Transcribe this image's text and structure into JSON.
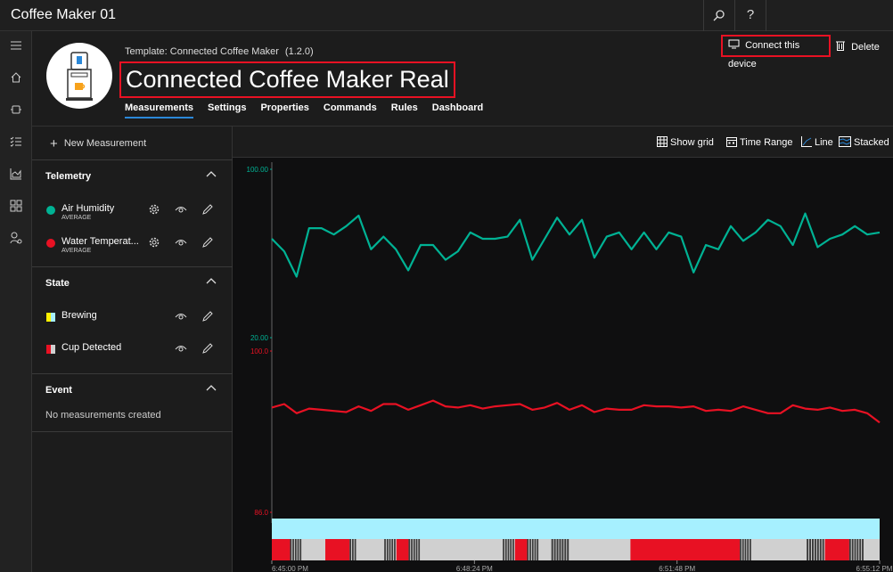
{
  "app": {
    "title": "Coffee Maker 01",
    "search_icon": "search-icon",
    "help_label": "?"
  },
  "header": {
    "template_label": "Template:",
    "template_name": "Connected Coffee Maker",
    "template_version": "(1.2.0)",
    "device_name": "Connected Coffee Maker Real",
    "connect_label": "Connect this device",
    "delete_label": "Delete",
    "tabs": [
      {
        "label": "Measurements",
        "active": true
      },
      {
        "label": "Settings"
      },
      {
        "label": "Properties"
      },
      {
        "label": "Commands"
      },
      {
        "label": "Rules"
      },
      {
        "label": "Dashboard"
      }
    ]
  },
  "left": {
    "new_measurement": "New Measurement",
    "telemetry": {
      "title": "Telemetry",
      "items": [
        {
          "label": "Air Humidity",
          "sub": "AVERAGE",
          "color": "#00b294"
        },
        {
          "label": "Water Temperat...",
          "sub": "AVERAGE",
          "color": "#e81123"
        }
      ]
    },
    "state": {
      "title": "State",
      "items": [
        {
          "label": "Brewing",
          "colors": [
            "#fff100",
            "#a6f0ff"
          ]
        },
        {
          "label": "Cup Detected",
          "colors": [
            "#e81123",
            "#d0d0d0"
          ]
        }
      ]
    },
    "event": {
      "title": "Event",
      "empty": "No measurements created"
    }
  },
  "toolbar": {
    "show_grid": "Show grid",
    "time_range": "Time Range",
    "line": "Line",
    "stacked": "Stacked"
  },
  "chart_data": {
    "type": "line",
    "series": [
      {
        "name": "Air Humidity",
        "color": "#00b294",
        "axis_labels": [
          "100.00",
          "20.00"
        ],
        "ylim": [
          20,
          100
        ],
        "values": [
          67,
          61,
          49,
          72,
          72,
          69,
          73,
          78,
          62,
          68,
          62,
          52,
          64,
          64,
          57,
          61,
          70,
          67,
          67,
          68,
          76,
          57,
          67,
          77,
          69,
          76,
          58,
          68,
          70,
          62,
          70,
          62,
          70,
          68,
          51,
          64,
          62,
          73,
          66,
          70,
          76,
          73,
          64,
          79,
          63,
          67,
          69,
          73,
          69,
          70
        ]
      },
      {
        "name": "Water Temperature",
        "color": "#e81123",
        "axis_labels": [
          "100.0",
          "86.0"
        ],
        "ylim": [
          86,
          100
        ],
        "values": [
          95.1,
          95.4,
          94.6,
          95.0,
          94.9,
          94.8,
          94.7,
          95.2,
          94.8,
          95.4,
          95.4,
          94.9,
          95.3,
          95.7,
          95.2,
          95.1,
          95.3,
          95.0,
          95.2,
          95.3,
          95.4,
          94.9,
          95.1,
          95.5,
          94.9,
          95.3,
          94.7,
          95.0,
          94.9,
          94.9,
          95.3,
          95.2,
          95.2,
          95.1,
          95.2,
          94.8,
          94.9,
          94.8,
          95.2,
          94.9,
          94.6,
          94.6,
          95.3,
          95.0,
          94.9,
          95.1,
          94.8,
          94.9,
          94.6,
          93.8
        ]
      }
    ],
    "x_tick_labels": [
      "6:45:00 PM",
      "6:48:24 PM",
      "6:51:48 PM",
      "6:55:12 PM"
    ],
    "state_tracks": [
      {
        "name": "Brewing",
        "segments": [
          {
            "from": 0,
            "to": 1,
            "color": "#a6f0ff"
          }
        ]
      },
      {
        "name": "Cup Detected",
        "segments": [
          {
            "from": 0.0,
            "to": 0.03,
            "color": "#e81123"
          },
          {
            "from": 0.03,
            "to": 0.05,
            "color": "#3a3a3a"
          },
          {
            "from": 0.088,
            "to": 0.128,
            "color": "#e81123"
          },
          {
            "from": 0.128,
            "to": 0.14,
            "color": "#3a3a3a"
          },
          {
            "from": 0.185,
            "to": 0.205,
            "color": "#3a3a3a"
          },
          {
            "from": 0.205,
            "to": 0.225,
            "color": "#e81123"
          },
          {
            "from": 0.225,
            "to": 0.245,
            "color": "#3a3a3a"
          },
          {
            "from": 0.38,
            "to": 0.4,
            "color": "#3a3a3a"
          },
          {
            "from": 0.4,
            "to": 0.42,
            "color": "#e81123"
          },
          {
            "from": 0.42,
            "to": 0.44,
            "color": "#3a3a3a"
          },
          {
            "from": 0.46,
            "to": 0.49,
            "color": "#3a3a3a"
          },
          {
            "from": 0.59,
            "to": 0.77,
            "color": "#e81123"
          },
          {
            "from": 0.77,
            "to": 0.79,
            "color": "#3a3a3a"
          },
          {
            "from": 0.88,
            "to": 0.91,
            "color": "#3a3a3a"
          },
          {
            "from": 0.91,
            "to": 0.95,
            "color": "#e81123"
          },
          {
            "from": 0.95,
            "to": 0.975,
            "color": "#3a3a3a"
          }
        ]
      }
    ],
    "track_base_color": "#d0d0d0"
  }
}
